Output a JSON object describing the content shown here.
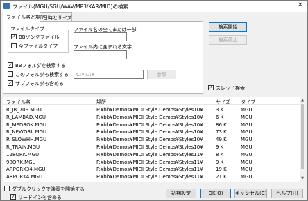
{
  "window": {
    "title": "ファイル(MGU/SGU/WAV/MP3/KAR/MID)の検索",
    "close_glyph": "✕"
  },
  "tabs": [
    "ファイル名と場所",
    "日時とサイズ"
  ],
  "file_type": {
    "label": "ファイルタイプ",
    "options": [
      {
        "label": "BBソングファイル",
        "checked": true
      },
      {
        "label": "全ファイルタイプ",
        "checked": false
      }
    ]
  },
  "filename_all_or_part": {
    "label": "ファイル名の全てまたは一部",
    "value": ""
  },
  "file_content": {
    "label": "ファイル内に含まれる文字",
    "value": ""
  },
  "search_options": [
    {
      "label": "BBフォルダを検索する",
      "checked": true
    },
    {
      "label": "このフォルダも検索する",
      "checked": false
    },
    {
      "label": "サブフォルダも含める",
      "checked": true
    }
  ],
  "folder_path": {
    "placeholder": "C:¥;D:¥"
  },
  "buttons": {
    "browse": "参照",
    "start": "検索開始",
    "stop": "検索停止",
    "reset": "初期設定",
    "ok": "OK(O)",
    "cancel": "キャンセル(C)",
    "help": "ヘルプ(H)"
  },
  "thread_search": {
    "label": "スレッド検索",
    "checked": true
  },
  "results": {
    "columns": [
      "ファイル名",
      "場所",
      "サイズ",
      "タイプ"
    ],
    "rows": [
      [
        "R_JB_70S.MGU",
        "F:¥bb¥Demos¥MIDI Style Demos¥Styles10¥",
        "3 K",
        "MGU"
      ],
      [
        "R_LAMBAD.MGU",
        "F:¥bb¥Demos¥MIDI Style Demos¥Styles10¥",
        "6 K",
        "MGU"
      ],
      [
        "R_MEDROK.MGU",
        "F:¥bb¥Demos¥MIDI Style Demos¥Styles10¥",
        "86 K",
        "MGU"
      ],
      [
        "R_NEWORL.MGU",
        "F:¥bb¥Demos¥MIDI Style Demos¥Styles10¥",
        "73 K",
        "MGU"
      ],
      [
        "R_SLOWHH.MGU",
        "F:¥bb¥Demos¥MIDI Style Demos¥Styles10¥",
        "49 K",
        "MGU"
      ],
      [
        "R_TRAIN.MGU",
        "F:¥bb¥Demos¥MIDI Style Demos¥Styles10¥",
        "9 K",
        "MGU"
      ],
      [
        "128ORK.MGU",
        "F:¥bb¥Demos¥MIDI Style Demos¥Styles11¥",
        "8 K",
        "MGU"
      ],
      [
        "98ORK.MGU",
        "F:¥bb¥Demos¥MIDI Style Demos¥Styles11¥",
        "9 K",
        "MGU"
      ],
      [
        "ARPORK34.MGU",
        "F:¥bb¥Demos¥MIDI Style Demos¥Styles11¥",
        "19 K",
        "MGU"
      ],
      [
        "ARPORK4.MGU",
        "F:¥bb¥Demos¥MIDI Style Demos¥Styles11¥",
        "21 K",
        "MGU"
      ]
    ]
  },
  "bottom_options": [
    {
      "label": "ダブルクリックで演奏を開始する",
      "checked": false
    },
    {
      "label": "リードインも含める",
      "checked": true
    }
  ],
  "glyphs": {
    "check": "✓",
    "scroll_up": "▲",
    "scroll_down": "▼"
  },
  "colors": {
    "default_button_border": "#0078d7",
    "titlebar": "#ffffff",
    "dialog_bg": "#f0f0f0"
  }
}
